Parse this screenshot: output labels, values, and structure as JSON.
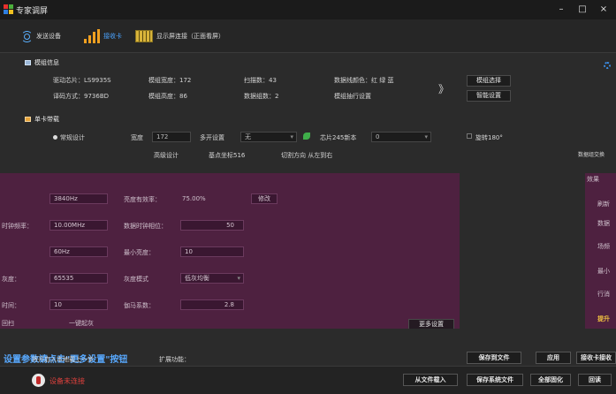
{
  "window": {
    "title": "专家调屏",
    "min_glyph": "–",
    "max_glyph": "□",
    "close_glyph": "×"
  },
  "tabs": [
    {
      "label": "发送设备",
      "icon": "signal-icon"
    },
    {
      "label": "接收卡",
      "icon": "bars-icon"
    },
    {
      "label": "显示屏连接（正面看屏）",
      "icon": "grid-icon"
    }
  ],
  "module_info": {
    "heading": "模组信息",
    "driver_chip": "驱动芯片：LS9935S",
    "decoding": "译码方式：9736BD",
    "module_width": "模组宽度：172",
    "module_height": "模组高度：86",
    "scan_count": "扫描数：43",
    "data_groups": "数据组数：2",
    "data_color": "数据线颜色：红 绿 蓝",
    "row_setting": "模组抽行设置",
    "arrow": "》",
    "select_btn": "模组选择",
    "smart_btn": "智能设置"
  },
  "card_settings": {
    "heading": "单卡带载",
    "normal_design": "常规设计",
    "advanced_design": "高级设计",
    "width_label": "宽度",
    "width_value": "172",
    "multi_open_label": "多开设置",
    "multi_open_value": "无",
    "chip_label": "芯片245新本",
    "chip_value": "0",
    "rotate_label": "旋转180°",
    "base_point": "基点坐标516",
    "cut_direction": "切割方向 从左到右"
  },
  "params": {
    "freq_value": "3840Hz",
    "brightness_eff_label": "亮度有效率：",
    "brightness_eff_value": "75.00%",
    "modify_btn": "修改",
    "clock_label": "时钟频率：",
    "clock_value": "10.00MHz",
    "data_phase_label": "数据时钟相位：",
    "data_phase_value": "50",
    "refresh_value": "60Hz",
    "min_brightness_label": "最小亮度：",
    "min_brightness_value": "10",
    "gray_label": "灰度：",
    "gray_value": "65535",
    "gray_mode_label": "灰度模式",
    "gray_mode_value": "低灰均衡",
    "time_label": "时间：",
    "time_value": "10",
    "gamma_label": "伽马系数：",
    "gamma_value": "2.8",
    "retrace_label": "回扫",
    "one_point_label": "一键起灰",
    "more_btn": "更多设置"
  },
  "hint": "设置参数请点击\"更多设置\"按钮",
  "right_panel": {
    "header": "数据组交换",
    "effect": "效果",
    "l1": "刷新",
    "l2": "数据",
    "l3": "场频",
    "l4": "最小",
    "l5": "行消",
    "l6": "提升"
  },
  "bottom_row1": {
    "ribbon_text": "将开启入本地载上一步",
    "extend_label": "扩展功能：",
    "save_file": "保存到文件",
    "apply": "应用",
    "receive": "接收卡接收"
  },
  "bottom": {
    "status": "设备未连接",
    "load_file": "从文件载入",
    "save_sys": "保存系统文件",
    "all_fix": "全部固化",
    "back": "回读"
  }
}
